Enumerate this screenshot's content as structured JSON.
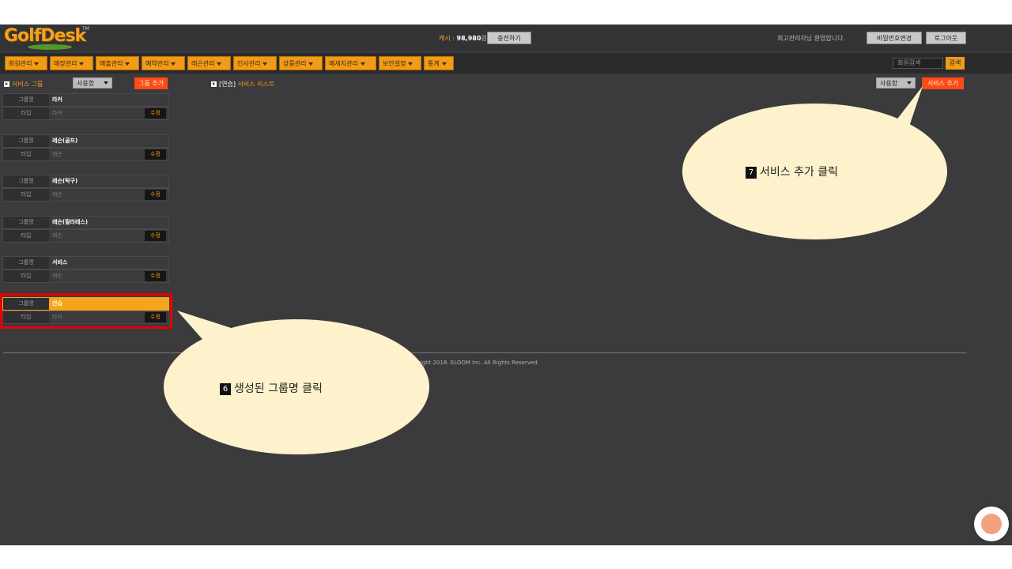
{
  "header": {
    "logo": "GolfDesk",
    "logo_tm": "TM",
    "cash_label": "캐시 : ",
    "cash_amount": "98,980",
    "cash_unit": "원",
    "charge_button": "충전하기",
    "welcome": "최고관리자님 환영합니다.",
    "change_password_button": "비밀번호변경",
    "logout_button": "로그아웃"
  },
  "nav": {
    "items": [
      {
        "label": "회원관리"
      },
      {
        "label": "매장관리"
      },
      {
        "label": "매출관리"
      },
      {
        "label": "예약관리"
      },
      {
        "label": "레슨관리"
      },
      {
        "label": "인사관리"
      },
      {
        "label": "상품관리"
      },
      {
        "label": "메세지관리"
      },
      {
        "label": "보안설정"
      },
      {
        "label": "통계"
      }
    ],
    "search_placeholder": "회원검색",
    "search_button": "검색"
  },
  "service_group": {
    "title": "서비스 그룹",
    "filter_value": "사용함",
    "add_button": "그룹 추가",
    "name_label": "그룹명",
    "type_label": "타입",
    "edit_label": "수정",
    "groups": [
      {
        "name": "라커",
        "type": "라커"
      },
      {
        "name": "레슨(골프)",
        "type": "레슨"
      },
      {
        "name": "레슨(탁구)",
        "type": "레슨"
      },
      {
        "name": "레슨(필라테스)",
        "type": "레슨"
      },
      {
        "name": "서비스",
        "type": "레슨"
      },
      {
        "name": "연습",
        "type": "타석"
      }
    ]
  },
  "service_list": {
    "group_tag": "[연습]",
    "title": "서비스 리스트",
    "filter_value": "사용함",
    "add_button": "서비스 추가"
  },
  "footer": {
    "copyright": "opyright 2018. ELOOM Inc. All Rights Reserved."
  },
  "callouts": [
    {
      "number": "7",
      "text": "서비스 추가 클릭"
    },
    {
      "number": "6",
      "text": "생성된 그룹명 클릭"
    }
  ],
  "colors": {
    "accent": "#f29b17",
    "danger": "#ff4a13",
    "highlight_border": "#e60000",
    "bubble": "#fdf2cb",
    "background": "#3b3b3d"
  }
}
